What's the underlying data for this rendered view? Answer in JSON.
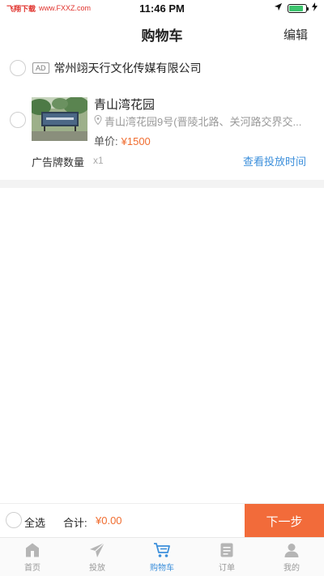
{
  "status_bar": {
    "carrier": "飞翔下载",
    "site": "www.FXXZ.com",
    "time": "11:46 PM",
    "battery_level": 0.85
  },
  "nav": {
    "title": "购物车",
    "edit_label": "编辑"
  },
  "shop": {
    "badge": "AD",
    "name": "常州翊天行文化传媒有限公司"
  },
  "item": {
    "title": "青山湾花园",
    "address": "青山湾花园9号(晋陵北路、关河路交界交...",
    "price_label": "单价:",
    "price": "¥1500",
    "qty_label": "广告牌数量",
    "qty": "x1",
    "view_time_label": "查看投放时间"
  },
  "checkout": {
    "select_all": "全选",
    "total_label": "合计:",
    "total_value": "¥0.00",
    "next_label": "下一步"
  },
  "tabs": [
    {
      "label": "首页",
      "icon": "home-icon"
    },
    {
      "label": "投放",
      "icon": "send-icon"
    },
    {
      "label": "购物车",
      "icon": "cart-icon",
      "active": true
    },
    {
      "label": "订单",
      "icon": "order-icon"
    },
    {
      "label": "我的",
      "icon": "profile-icon"
    }
  ],
  "colors": {
    "accent": "#f26b3a",
    "link": "#3c8fdb",
    "price": "#f06d30"
  }
}
